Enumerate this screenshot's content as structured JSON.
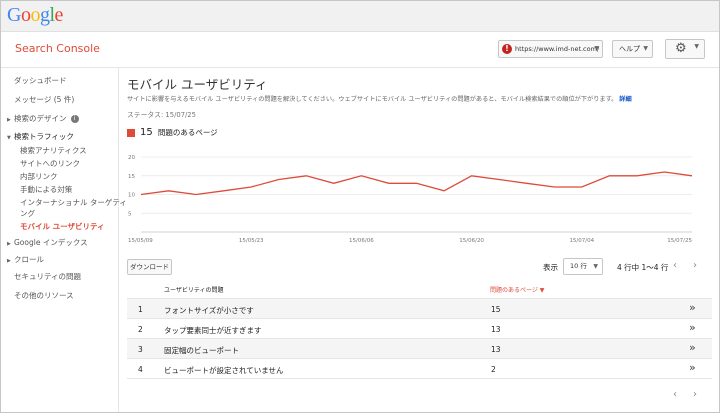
{
  "brand": {
    "logo_letters": [
      {
        "ch": "G",
        "color": "#4285f4"
      },
      {
        "ch": "o",
        "color": "#ea4335"
      },
      {
        "ch": "o",
        "color": "#fbbc05"
      },
      {
        "ch": "g",
        "color": "#4285f4"
      },
      {
        "ch": "l",
        "color": "#34a853"
      },
      {
        "ch": "e",
        "color": "#ea4335"
      }
    ]
  },
  "header": {
    "app_title": "Search Console",
    "site_url": "https://www.imd-net.com/",
    "help_label": "ヘルプ",
    "warning_icon": "!",
    "gear_icon": "⚙"
  },
  "sidebar": {
    "items": [
      {
        "label": "ダッシュボード"
      },
      {
        "label": "メッセージ (5 件)"
      },
      {
        "label": "検索のデザイン"
      },
      {
        "label": "検索トラフィック"
      },
      {
        "label": "検索アナリティクス"
      },
      {
        "label": "サイトへのリンク"
      },
      {
        "label": "内部リンク"
      },
      {
        "label": "手動による対策"
      },
      {
        "label": "インターナショナル ターゲティ"
      },
      {
        "label": "ング"
      },
      {
        "label": "モバイル ユーザビリティ"
      },
      {
        "label": "Google インデックス"
      },
      {
        "label": "クロール"
      },
      {
        "label": "セキュリティの問題"
      },
      {
        "label": "その他のリソース"
      }
    ]
  },
  "main": {
    "title": "モバイル ユーザビリティ",
    "description": "サイトに影響を与えるモバイル ユーザビリティの問題を解決してください。ウェブサイトにモバイル ユーザビリティの問題があると、モバイル検索結果での順位が下がります。",
    "more_link": "詳細",
    "status": "ステータス: 15/07/25",
    "legend_count": "15",
    "legend_label": "問題のあるページ",
    "download_label": "ダウンロード",
    "show_label": "表示",
    "rows_option": "10 行",
    "range_text": "4 行中 1〜4 行",
    "prev_icon": "‹",
    "next_icon": "›",
    "table": {
      "headers": [
        "ユーザビリティの問題",
        "問題のあるページ ▼"
      ],
      "rows": [
        {
          "idx": "1",
          "name": "フォントサイズが小さです",
          "count": "15"
        },
        {
          "idx": "2",
          "name": "タップ要素同士が近すぎます",
          "count": "13"
        },
        {
          "idx": "3",
          "name": "固定幅のビューポート",
          "count": "13"
        },
        {
          "idx": "4",
          "name": "ビューポートが設定されていません",
          "count": "2"
        }
      ],
      "row_action_icon": "»"
    }
  },
  "chart_data": {
    "type": "line",
    "x_tick_labels": [
      "15/05/09",
      "15/05/23",
      "15/06/06",
      "15/06/20",
      "15/07/04",
      "15/07/25"
    ],
    "y_tick_labels": [
      "20",
      "15",
      "10",
      "5"
    ],
    "ylim": [
      0,
      20
    ],
    "grid": true,
    "series": [
      {
        "color": "#dd4b39",
        "values": [
          10,
          11,
          10,
          11,
          12,
          14,
          15,
          13,
          15,
          13,
          13,
          11,
          15,
          14,
          13,
          12,
          12,
          15,
          15,
          16,
          15
        ]
      }
    ]
  }
}
